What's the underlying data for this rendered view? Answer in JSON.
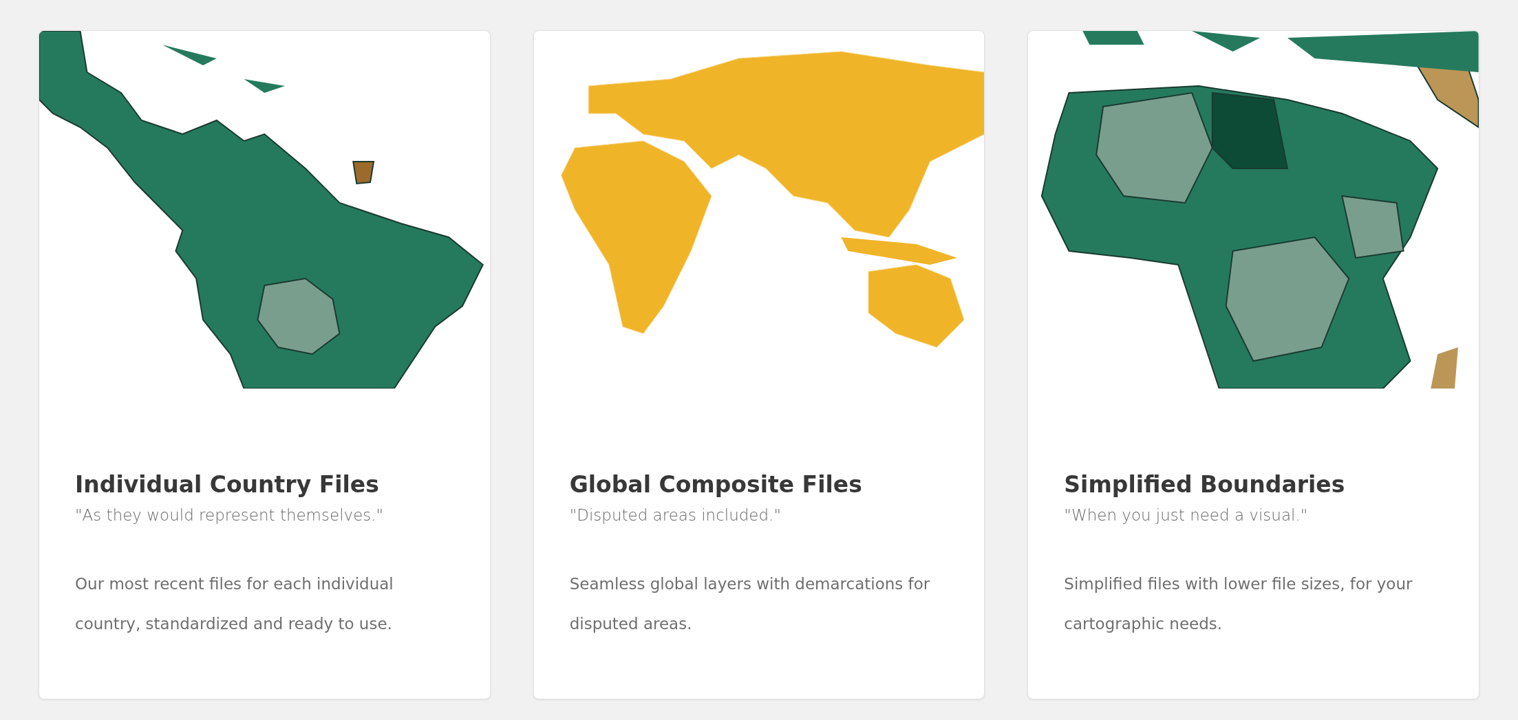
{
  "cards": [
    {
      "kind": "country",
      "title": "Individual Country Files",
      "quote": "\"As they would represent themselves.\"",
      "description": "Our most recent files for each individual country, standardized and ready to use."
    },
    {
      "kind": "global",
      "title": "Global Composite Files",
      "quote": "\"Disputed areas included.\"",
      "description": "Seamless global layers with demarcations for disputed areas."
    },
    {
      "kind": "simplified",
      "title": "Simplified Boundaries",
      "quote": "\"When you just need a visual.\"",
      "description": "Simplified files with lower file sizes, for your cartographic needs."
    }
  ]
}
